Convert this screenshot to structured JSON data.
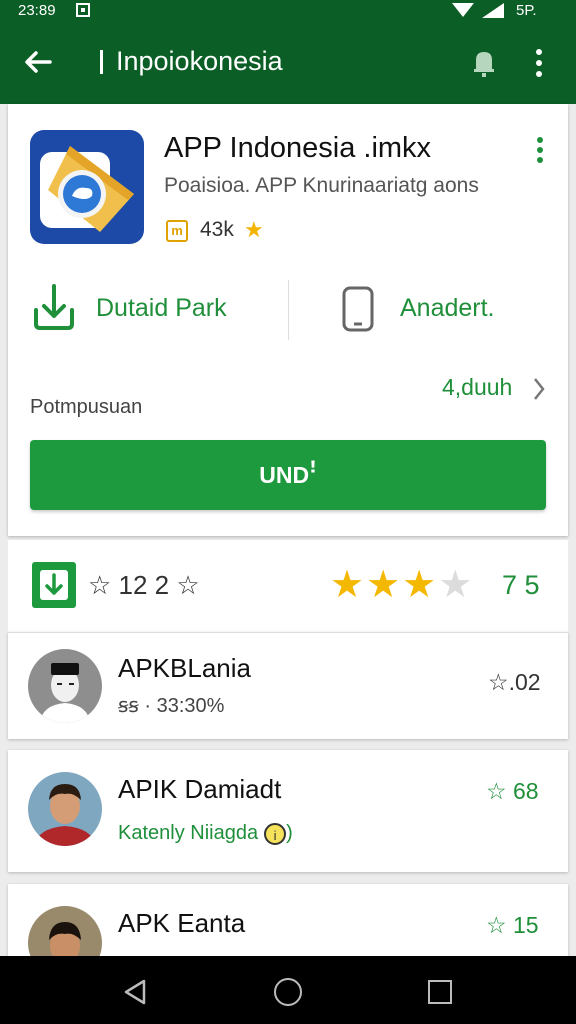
{
  "status": {
    "time": "23:89",
    "battery": "5P.",
    "icons": [
      "screenshot-icon",
      "wifi-icon",
      "signal-icon",
      "battery-icon"
    ]
  },
  "appbar": {
    "title": "Inpoiokonesia",
    "icons": [
      "back-arrow-icon",
      "notification-icon",
      "overflow-menu-icon"
    ]
  },
  "app": {
    "name": "APP Indonesia .imkx",
    "subtitle": "Poaisioa. APP Knurinaariatg aons",
    "count": "43k",
    "count_star": "★",
    "icon": "app-logo-icon"
  },
  "actions": [
    {
      "label": "Dutaid Park",
      "icon": "download-arrow-icon"
    },
    {
      "label": "Anadert.",
      "icon": "phone-icon"
    }
  ],
  "permissions": {
    "label": "Potmpusuan",
    "link": "4,duuh"
  },
  "install_button": "UNDꜝ",
  "rating_bar": {
    "left_text": "☆ 12 2 ☆",
    "stars_filled": 3,
    "stars_total": 4,
    "score": "7 5"
  },
  "reviews": [
    {
      "name": "APKBLania",
      "meta": "ꞩꞩ · 33:30%",
      "value": "☆.02"
    },
    {
      "name": "APIK Damiadt",
      "meta": "Katenly Niiagda",
      "value": "☆ 68"
    },
    {
      "name": "APK Eanta",
      "meta": "",
      "value": "☆ 15"
    }
  ],
  "colors": {
    "primary": "#0b5e25",
    "accent": "#1e9a3e",
    "star": "#f5b800"
  },
  "navigation": {
    "icons": [
      "nav-back-icon",
      "nav-home-icon",
      "nav-recents-icon"
    ]
  }
}
